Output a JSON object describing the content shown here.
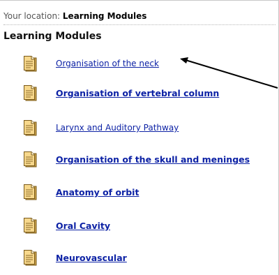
{
  "breadcrumb": {
    "prefix": "Your location: ",
    "current": "Learning Modules"
  },
  "heading": "Learning Modules",
  "modules": [
    {
      "label": "Organisation of the neck",
      "bold": false
    },
    {
      "label": "Organisation of vertebral column",
      "bold": true
    },
    {
      "label": "Larynx and Auditory Pathway",
      "bold": false
    },
    {
      "label": "Organisation of the skull and meninges",
      "bold": true
    },
    {
      "label": "Anatomy of orbit",
      "bold": true
    },
    {
      "label": "Oral Cavity",
      "bold": true
    },
    {
      "label": "Neurovascular",
      "bold": true
    }
  ],
  "icons": {
    "module": "document-icon",
    "annotation": "arrow-pointer"
  },
  "colors": {
    "link": "#0d22a5",
    "icon_page": "#f7d88c",
    "icon_outline": "#7a5a1a"
  }
}
